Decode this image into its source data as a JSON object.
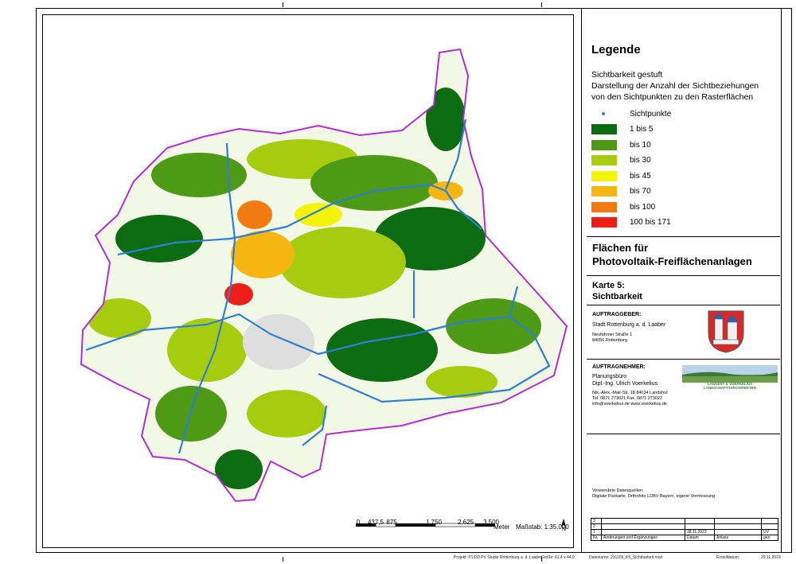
{
  "legend": {
    "title": "Legende",
    "subtitle_lines": [
      "Sichtbarkeit gestuft",
      "Darstellung der Anzahl der Sichtbeziehungen",
      "von den Sichtpunkten zu den Rasterflächen"
    ],
    "point_label": "Sichtpunkte",
    "point_color": "#2f7fd1",
    "classes": [
      {
        "label": "1 bis 5",
        "color": "#0d6b12"
      },
      {
        "label": "bis 10",
        "color": "#4e9a16"
      },
      {
        "label": "bis 30",
        "color": "#a6cc0f"
      },
      {
        "label": "bis 45",
        "color": "#f4f30a"
      },
      {
        "label": "bis 70",
        "color": "#f6b612"
      },
      {
        "label": "bis 100",
        "color": "#f27a10"
      },
      {
        "label": "100 bis 171",
        "color": "#ec2018"
      }
    ]
  },
  "title": {
    "line1": "Flächen für",
    "line2": "Photovoltaik-Freiflächenanlagen",
    "karte": "Karte 5:",
    "karte_name": "Sichtbarkeit"
  },
  "auftraggeber": {
    "heading": "AUFTRAGGEBER:",
    "name": "Stadt Rottenburg a. d. Laaber",
    "street": "Neufahrner Straße 1",
    "city": "84056 Rottenburg"
  },
  "auftragnehmer": {
    "heading": "AUFTRAGNEHMER:",
    "line1": "Planungsbüro",
    "line2": "Dipl.-Ing. Ulrich Voerkelius",
    "address": "Nik.-Alex.-Mair-Str. 18  84034 Landshut",
    "phone": "Tel. 0871 273021  Fax. 0871 273022",
    "web": "info@voerkelius.de    www.voerkelius.de",
    "logo_text": "LANGEST & VOERKELIUS  LANDSCHAFTSARCHITEKTEN"
  },
  "sources": {
    "heading": "Verwendete Datenquellen:",
    "text": "Digitale Flurkarte,  Orthofoto LDBV Bayern, eigene Vermessung"
  },
  "revision_table": {
    "rows": [
      "3",
      "2",
      "1"
    ],
    "date": "28.11.2023",
    "initials": "UV",
    "headers": [
      "Nr.",
      "Änderungen und Ergänzungen",
      "Datum",
      "Anlass",
      "gez."
    ]
  },
  "scale": {
    "ticks": [
      "0",
      "437,5",
      "875",
      "1.750",
      "2.625",
      "3.500"
    ],
    "unit": "Meter",
    "label": "Maßstab: 1:35.000",
    "north": "N"
  },
  "footer": {
    "project": "Projekt: P1333 PV Studie Rottenburg a. d. Laaber",
    "size": "Größe: 61,4 x 44,0",
    "file": "Dateiname: 231109_K5_Sichtbarkeit.mxd",
    "created": "Erstelldatum:",
    "date": "29.11.2023"
  }
}
